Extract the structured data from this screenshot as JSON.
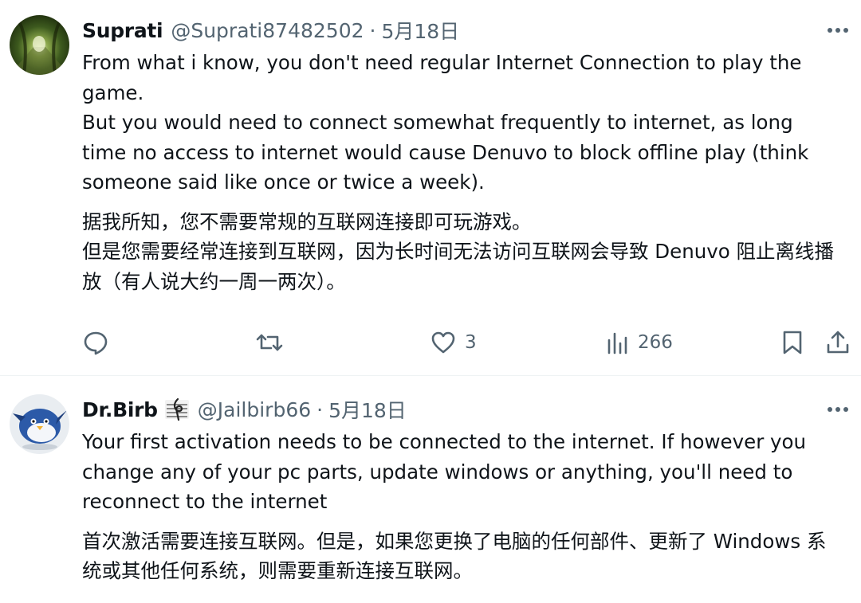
{
  "tweets": [
    {
      "display_name": "Suprati",
      "handle": "@Suprati87482502",
      "separator": "·",
      "date": "5月18日",
      "text_en_1": "From what i know, you don't need regular Internet Connection to play the game.",
      "text_en_2": "But you would need to connect somewhat frequently to internet, as long time no access to internet would cause Denuvo to block offline play (think someone said like once or twice a week).",
      "text_zh_1": "据我所知，您不需要常规的互联网连接即可玩游戏。",
      "text_zh_2": "但是您需要经常连接到互联网，因为长时间无法访问互联网会导致 Denuvo 阻止离线播放（有人说大约一周一两次）。",
      "likes": "3",
      "views": "266"
    },
    {
      "display_name": "Dr.Birb",
      "badge": "music-note-badge",
      "handle": "@Jailbirb66",
      "separator": "·",
      "date": "5月18日",
      "text_en_1": "Your first activation needs to be connected to the internet. If however you change any of your pc parts, update windows or anything, you'll need to reconnect to the internet",
      "text_zh_1": "首次激活需要连接互联网。但是，如果您更换了电脑的任何部件、更新了 Windows 系统或其他任何系统，则需要重新连接互联网。"
    }
  ],
  "icons": {
    "reply": "reply-icon",
    "retweet": "retweet-icon",
    "like": "heart-icon",
    "views": "views-icon",
    "bookmark": "bookmark-icon",
    "share": "share-icon",
    "more": "more-icon"
  },
  "colors": {
    "text": "#0f1419",
    "secondary": "#536471",
    "divider": "#eff3f4"
  }
}
